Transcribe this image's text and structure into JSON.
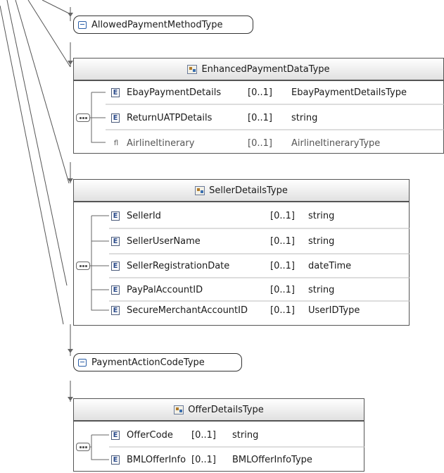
{
  "allowed_payment": {
    "label": "AllowedPaymentMethodType"
  },
  "enhanced": {
    "title": "EnhancedPaymentDataType",
    "rows": [
      {
        "name": "EbayPaymentDetails",
        "card": "[0..1]",
        "type": "EbayPaymentDetailsType",
        "icon": "element-icon"
      },
      {
        "name": "ReturnUATPDetails",
        "card": "[0..1]",
        "type": "string",
        "icon": "element-icon"
      },
      {
        "name": "AirlineItinerary",
        "card": "[0..1]",
        "type": "AirlineItineraryType",
        "icon": "attribute-icon"
      }
    ]
  },
  "seller": {
    "title": "SellerDetailsType",
    "rows": [
      {
        "name": "SellerId",
        "card": "[0..1]",
        "type": "string"
      },
      {
        "name": "SellerUserName",
        "card": "[0..1]",
        "type": "string"
      },
      {
        "name": "SellerRegistrationDate",
        "card": "[0..1]",
        "type": "dateTime"
      },
      {
        "name": "PayPalAccountID",
        "card": "[0..1]",
        "type": "string"
      },
      {
        "name": "SecureMerchantAccountID",
        "card": "[0..1]",
        "type": "UserIDType"
      }
    ]
  },
  "payment_action": {
    "label": "PaymentActionCodeType"
  },
  "offer": {
    "title": "OfferDetailsType",
    "rows": [
      {
        "name": "OfferCode",
        "card": "[0..1]",
        "type": "string"
      },
      {
        "name": "BMLOfferInfo",
        "card": "[0..1]",
        "type": "BMLOfferInfoType"
      }
    ]
  },
  "icons": {
    "element": "E",
    "attribute": "ﬂ"
  }
}
